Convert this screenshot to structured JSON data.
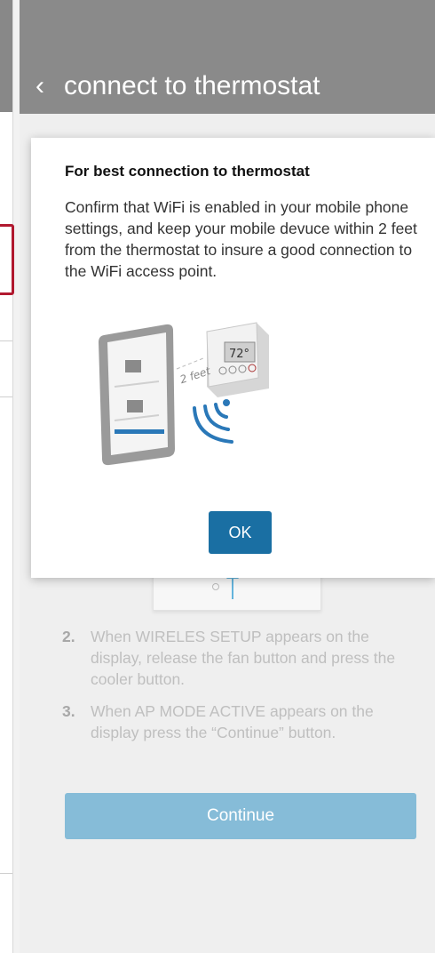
{
  "header": {
    "back_icon": "chevron-left-icon",
    "title": "connect to thermostat"
  },
  "modal": {
    "title": "For best connection to thermostat",
    "body": "Confirm that WiFi is enabled in your mobile phone settings, and keep your mobile devuce within 2 feet from the thermostat to insure a good connection to the WiFi access point.",
    "illustration": {
      "distance_label": "2 feet",
      "thermostat_reading": "72°"
    },
    "ok_label": "OK"
  },
  "steps": [
    {
      "number": "2.",
      "text": "When WIRELES SETUP appears on the display, release the fan button and press the cooler button."
    },
    {
      "number": "3.",
      "text": "When AP MODE ACTIVE appears on the display press the “Continue” button."
    }
  ],
  "continue_label": "Continue",
  "colors": {
    "header": "#8a8a8a",
    "ok_button": "#1a6fa3",
    "continue_button": "#86bcd8",
    "highlight": "#b1192f"
  }
}
